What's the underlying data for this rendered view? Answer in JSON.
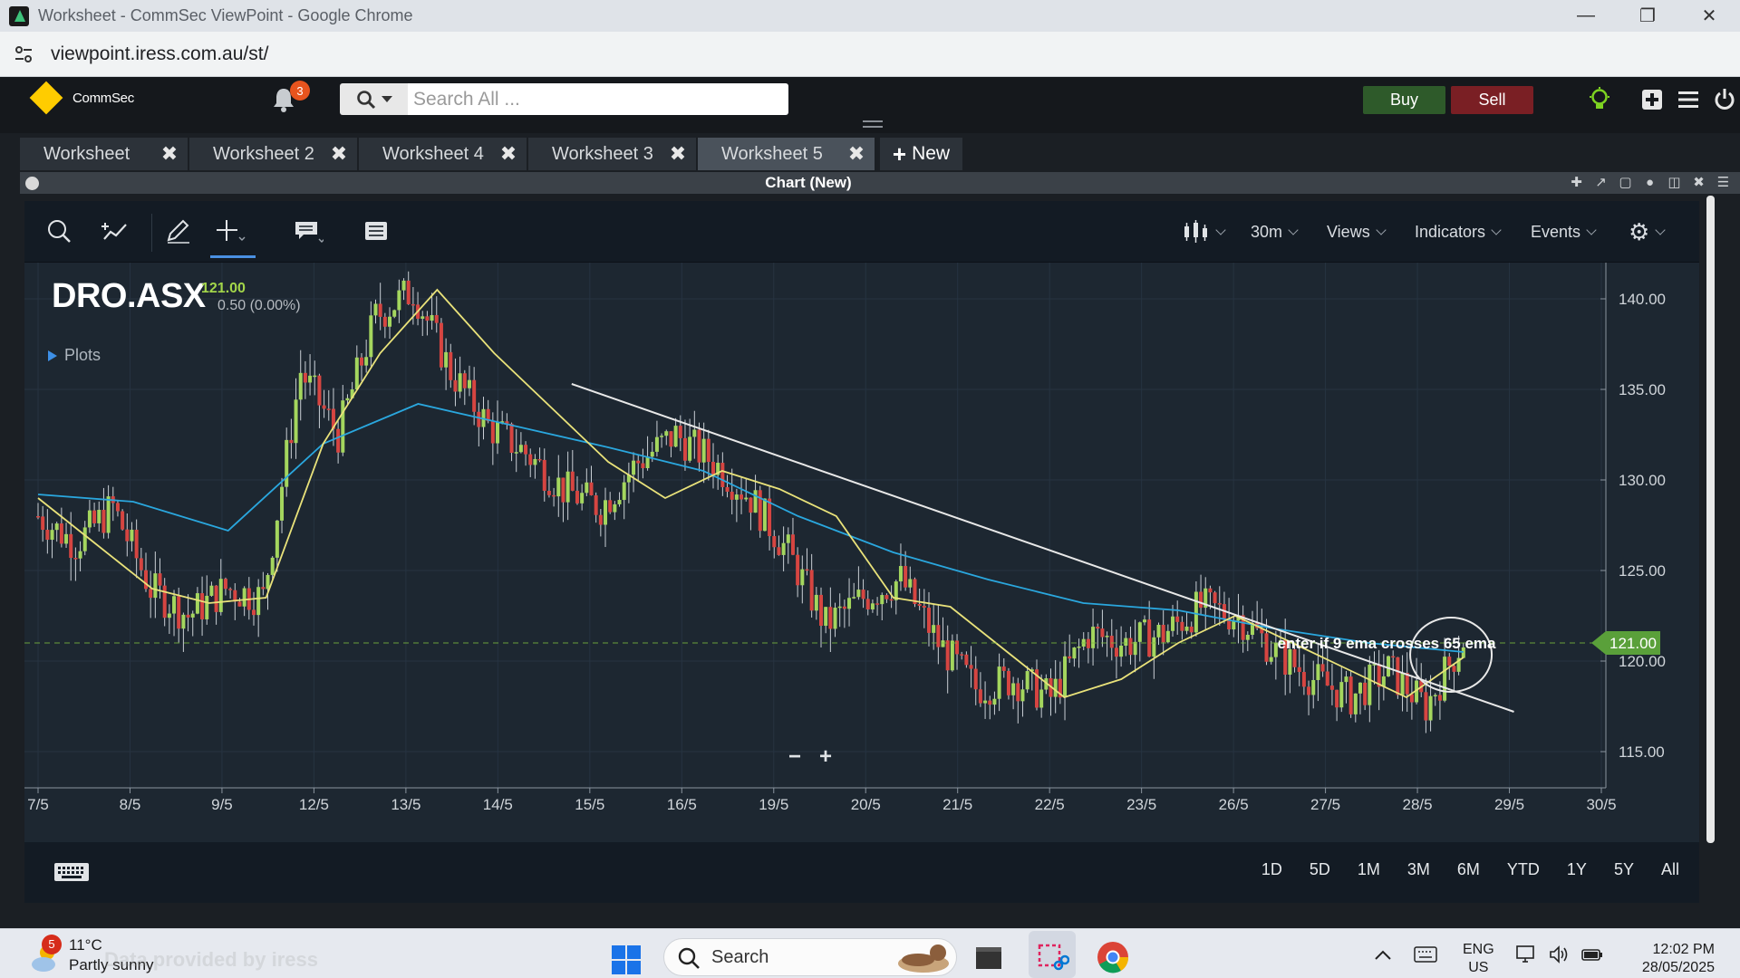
{
  "window": {
    "title": "Worksheet - CommSec ViewPoint - Google Chrome",
    "minimize_icon": "minimize-icon",
    "restore_icon": "restore-icon",
    "close_icon": "close-icon"
  },
  "address_bar": {
    "url": "viewpoint.iress.com.au/st/"
  },
  "header": {
    "logo_text": "CommSec",
    "notifications_count": "3",
    "search_placeholder": "Search All ...",
    "buy_label": "Buy",
    "sell_label": "Sell"
  },
  "tabs": [
    {
      "label": "Worksheet",
      "active": false
    },
    {
      "label": "Worksheet 2",
      "active": false
    },
    {
      "label": "Worksheet 4",
      "active": false
    },
    {
      "label": "Worksheet 3",
      "active": false
    },
    {
      "label": "Worksheet 5",
      "active": true
    }
  ],
  "new_tab_label": "New",
  "panel": {
    "title": "Chart (New)"
  },
  "chart_toolbar": {
    "interval": "30m",
    "views": "Views",
    "indicators": "Indicators",
    "events": "Events"
  },
  "quote": {
    "symbol": "DRO.ASX",
    "last": "121.00",
    "change": "0.50 (0.00%)",
    "plots_label": "Plots"
  },
  "chart_data": {
    "type": "candlestick",
    "x_ticks": [
      "7/5",
      "8/5",
      "9/5",
      "12/5",
      "13/5",
      "14/5",
      "15/5",
      "16/5",
      "19/5",
      "20/5",
      "21/5",
      "22/5",
      "23/5",
      "26/5",
      "27/5",
      "28/5",
      "29/5",
      "30/5"
    ],
    "y_ticks": [
      "140.00",
      "135.00",
      "130.00",
      "125.00",
      "120.00",
      "115.00"
    ],
    "ylim": [
      113,
      142
    ],
    "current_price": 121.0,
    "current_price_label": "121.00",
    "annotation": "enter if 9 ema crosses 65 ema",
    "series": [
      {
        "name": "price",
        "values": [
          128,
          126.5,
          128.5,
          124,
          122.5,
          124,
          123.5,
          136,
          132.5,
          139,
          140.5,
          136,
          133,
          131.5,
          129.5,
          128.5,
          131,
          132.5,
          131,
          129,
          126,
          122,
          123.5,
          124.5,
          121,
          118.5,
          119,
          118,
          121.5,
          121,
          121.5,
          123,
          122.5,
          120.5,
          119,
          118,
          119.5,
          117.5,
          121.2
        ]
      },
      {
        "name": "ema9",
        "values": [
          129,
          126.5,
          124,
          123.2,
          123.5,
          132,
          137,
          140.5,
          137,
          134,
          131,
          129,
          130.5,
          129.5,
          128,
          123.5,
          123,
          120.5,
          118,
          119,
          121,
          122.5,
          121,
          119.5,
          118,
          120.2
        ]
      },
      {
        "name": "ema65",
        "values": [
          129.2,
          128.8,
          127.2,
          132,
          134.2,
          133,
          131.8,
          130.5,
          128,
          126,
          124.5,
          123.2,
          122.8,
          121.8,
          121,
          120.5
        ]
      }
    ],
    "trendline": {
      "from": [
        "15/5",
        135.3
      ],
      "to": [
        "29/5",
        117.2
      ]
    }
  },
  "ranges": [
    "1D",
    "5D",
    "1M",
    "3M",
    "6M",
    "YTD",
    "1Y",
    "5Y",
    "All"
  ],
  "taskbar": {
    "weather_badge": "5",
    "temperature": "11°C",
    "condition": "Partly sunny",
    "watermark": "Data provided by iress",
    "search_label": "Search",
    "language_line1": "ENG",
    "language_line2": "US",
    "time": "12:02 PM",
    "date": "28/05/2025"
  }
}
